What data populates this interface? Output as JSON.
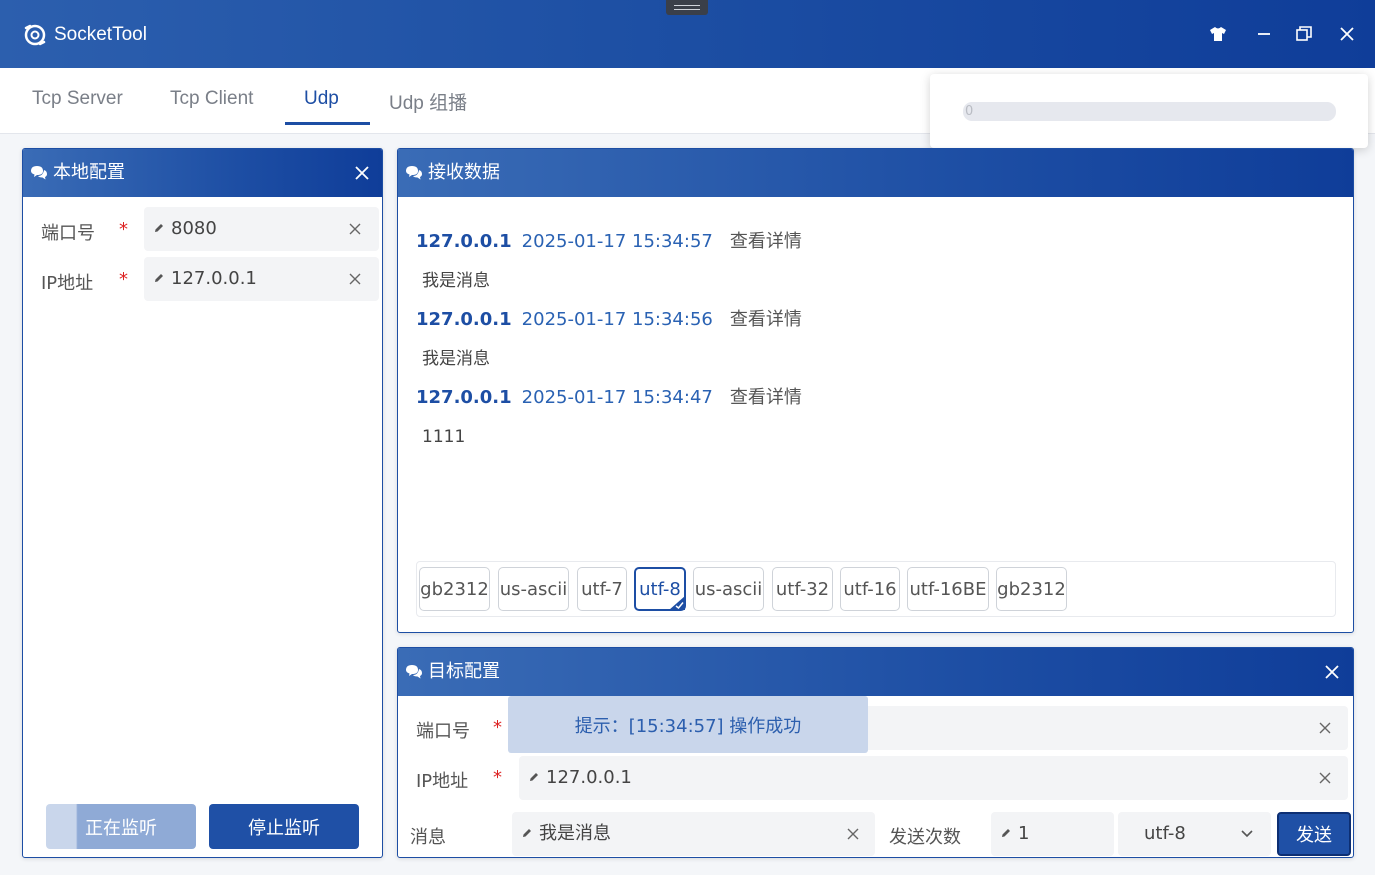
{
  "window": {
    "title": "SocketTool"
  },
  "tabs": [
    {
      "label": "Tcp Server"
    },
    {
      "label": "Tcp Client"
    },
    {
      "label": "Udp"
    },
    {
      "label": "Udp 组播"
    }
  ],
  "active_tab": "Udp",
  "progress": {
    "text": "0",
    "value": 0
  },
  "local_config": {
    "title": "本地配置",
    "port_label": "端口号",
    "port_value": "8080",
    "ip_label": "IP地址",
    "ip_value": "127.0.0.1",
    "required_mark": "*",
    "listening_button": "正在监听",
    "stop_button": "停止监听"
  },
  "receive": {
    "title": "接收数据",
    "messages": [
      {
        "ip": "127.0.0.1",
        "time": "2025-01-17 15:34:57",
        "detail": "查看详情",
        "body": "我是消息"
      },
      {
        "ip": "127.0.0.1",
        "time": "2025-01-17 15:34:56",
        "detail": "查看详情",
        "body": "我是消息"
      },
      {
        "ip": "127.0.0.1",
        "time": "2025-01-17 15:34:47",
        "detail": "查看详情",
        "body": "1111"
      }
    ],
    "encodings": [
      "gb2312",
      "us-ascii",
      "utf-7",
      "utf-8",
      "us-ascii",
      "utf-32",
      "utf-16",
      "utf-16BE",
      "gb2312"
    ],
    "selected_encoding": "utf-8"
  },
  "target_config": {
    "title": "目标配置",
    "port_label": "端口号",
    "ip_label": "IP地址",
    "ip_value": "127.0.0.1",
    "required_mark": "*",
    "message_label": "消息",
    "message_value": "我是消息",
    "send_count_label": "发送次数",
    "send_count_value": "1",
    "encoding_value": "utf-8",
    "send_button": "发送"
  },
  "toast": {
    "text": "提示：[15:34:57] 操作成功"
  },
  "colors": {
    "primary": "#1d4ea4",
    "accent": "#2c5fae",
    "required": "#dd2222",
    "toast_bg": "#c9d6eb"
  }
}
